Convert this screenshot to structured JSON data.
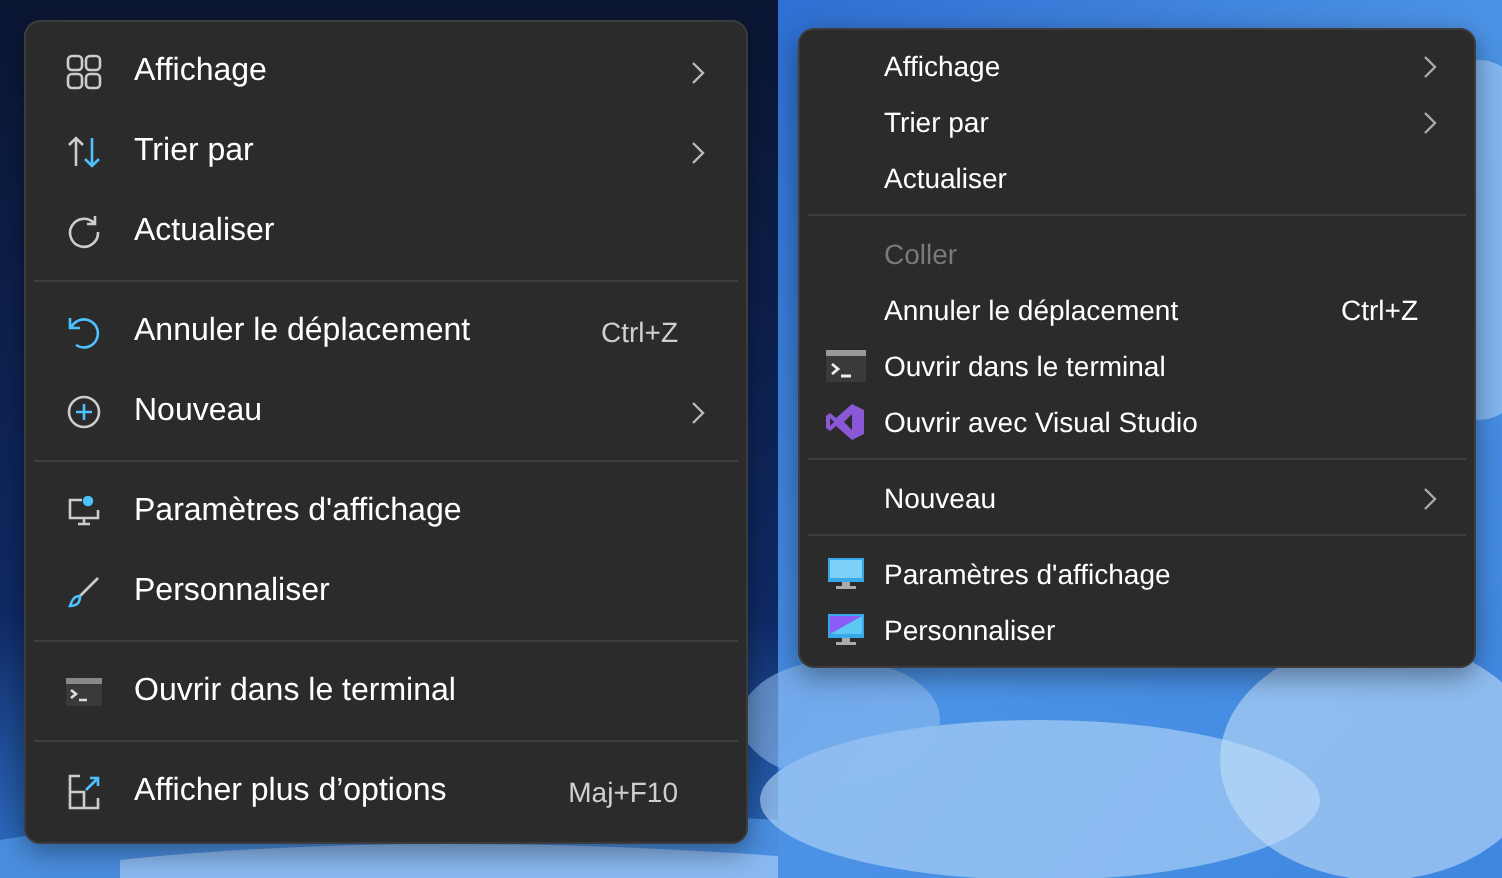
{
  "menus": [
    {
      "entries": [
        {
          "kind": "item",
          "label": "Affichage",
          "submenu": true,
          "disabled": false
        },
        {
          "kind": "item",
          "label": "Trier par",
          "submenu": true,
          "disabled": false
        },
        {
          "kind": "item",
          "label": "Actualiser",
          "submenu": false,
          "disabled": false
        },
        {
          "kind": "separator"
        },
        {
          "kind": "item",
          "label": "Annuler le déplacement",
          "shortcut": "Ctrl+Z",
          "submenu": false,
          "disabled": false
        },
        {
          "kind": "item",
          "label": "Nouveau",
          "submenu": true,
          "disabled": false
        },
        {
          "kind": "separator"
        },
        {
          "kind": "item",
          "label": "Paramètres d'affichage",
          "submenu": false,
          "disabled": false
        },
        {
          "kind": "item",
          "label": "Personnaliser",
          "submenu": false,
          "disabled": false
        },
        {
          "kind": "separator"
        },
        {
          "kind": "item",
          "label": "Ouvrir dans le terminal",
          "submenu": false,
          "disabled": false
        },
        {
          "kind": "separator"
        },
        {
          "kind": "item",
          "label": "Afficher plus d’options",
          "shortcut": "Maj+F10",
          "submenu": false,
          "disabled": false
        }
      ]
    },
    {
      "entries": [
        {
          "kind": "item",
          "label": "Affichage",
          "submenu": true,
          "disabled": false
        },
        {
          "kind": "item",
          "label": "Trier par",
          "submenu": true,
          "disabled": false
        },
        {
          "kind": "item",
          "label": "Actualiser",
          "submenu": false,
          "disabled": false
        },
        {
          "kind": "separator"
        },
        {
          "kind": "item",
          "label": "Coller",
          "submenu": false,
          "disabled": true
        },
        {
          "kind": "item",
          "label": "Annuler le déplacement",
          "shortcut": "Ctrl+Z",
          "submenu": false,
          "disabled": false
        },
        {
          "kind": "item",
          "label": "Ouvrir dans le terminal",
          "submenu": false,
          "disabled": false
        },
        {
          "kind": "item",
          "label": "Ouvrir avec Visual Studio",
          "submenu": false,
          "disabled": false
        },
        {
          "kind": "separator"
        },
        {
          "kind": "item",
          "label": "Nouveau",
          "submenu": true,
          "disabled": false
        },
        {
          "kind": "separator"
        },
        {
          "kind": "item",
          "label": "Paramètres d'affichage",
          "submenu": false,
          "disabled": false
        },
        {
          "kind": "item",
          "label": "Personnaliser",
          "submenu": false,
          "disabled": false
        }
      ]
    }
  ]
}
